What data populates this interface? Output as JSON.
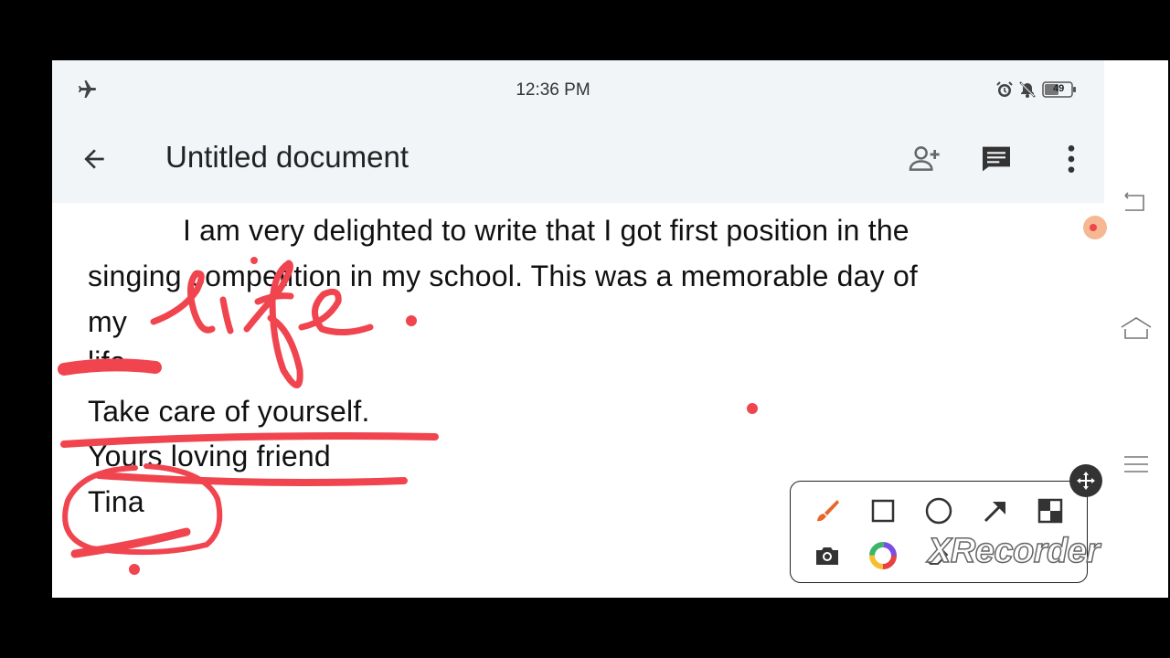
{
  "status": {
    "time": "12:36 PM",
    "battery": "49"
  },
  "appbar": {
    "title": "Untitled document"
  },
  "document": {
    "lines": [
      "I am very delighted to write that I got first position in the",
      "singing competition in my school. This was a memorable day of",
      "my",
      "life.",
      "Take care of yourself.",
      "Yours loving friend",
      "Tina"
    ],
    "annotation": "life"
  },
  "recorder": {
    "watermark": "XRecorder"
  },
  "colors": {
    "ink": "#f0444f",
    "brush": "#e8662b",
    "chrome": "#f1f5f8"
  }
}
